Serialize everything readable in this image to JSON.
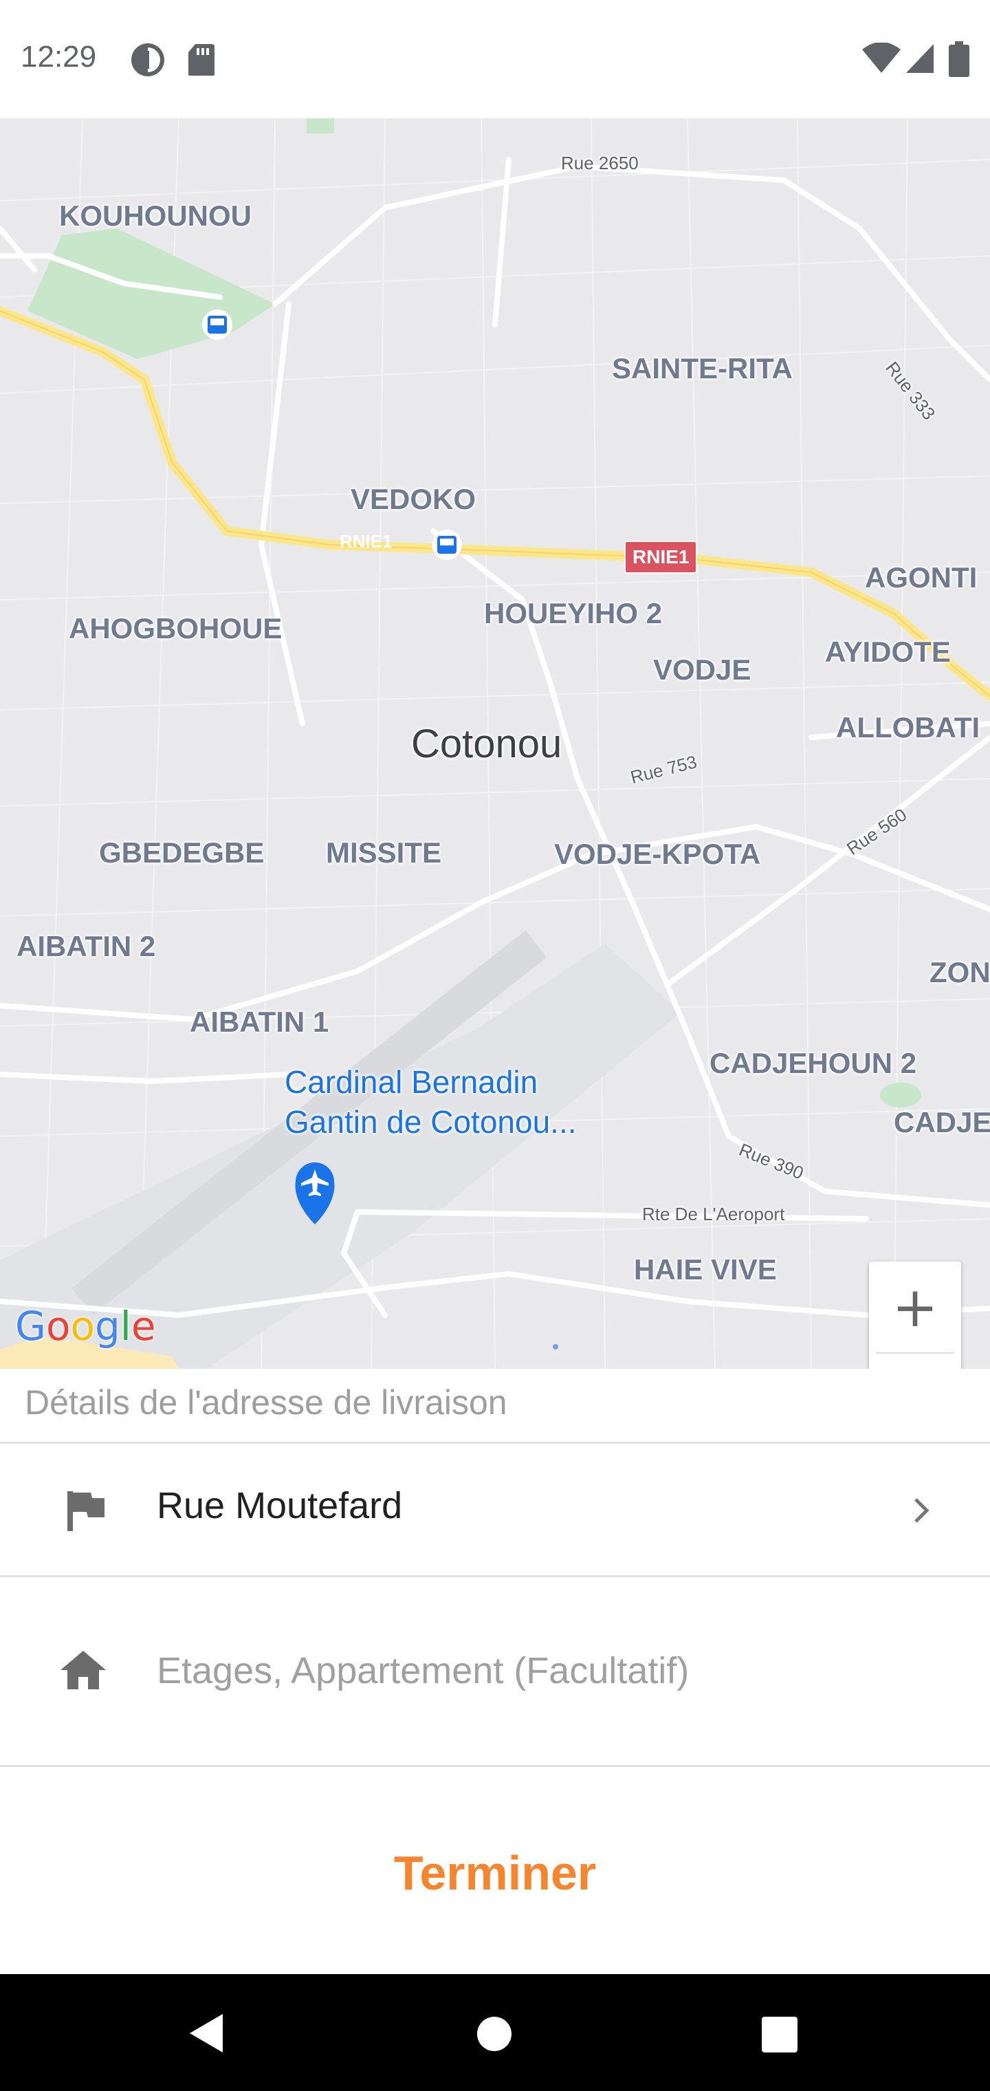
{
  "status_bar": {
    "time": "12:29",
    "icons": [
      "data-saver-icon",
      "sd-card-icon",
      "wifi-icon",
      "cell-signal-icon",
      "battery-icon"
    ]
  },
  "map": {
    "city": "Cotonou",
    "neighborhoods": {
      "kouhounou": "KOUHOUNOU",
      "sainte_rita": "SAINTE-RITA",
      "vedoko": "VEDOKO",
      "agonti": "AGONTI",
      "ahogbohoue": "AHOGBOHOUE",
      "houeyiho2": "HOUEYIHO 2",
      "ayidote": "AYIDOTE",
      "vodje": "VODJE",
      "allobati": "ALLOBATI",
      "gbedegbe": "GBEDEGBE",
      "missite": "MISSITE",
      "vodje_kpota": "VODJE-KPOTA",
      "aibatin2": "AIBATIN 2",
      "zon": "ZON",
      "aibatin1": "AIBATIN 1",
      "cadjehoun2": "CADJEHOUN 2",
      "cadjeh": "CADJEH",
      "haie_vive": "HAIE VIVE"
    },
    "streets": {
      "rue2650": "Rue 2650",
      "rue333": "Rue 333",
      "rnie1": "RNIE1",
      "rue753": "Rue 753",
      "rue560": "Rue 560",
      "rue390": "Rue 390",
      "rte_aeroport": "Rte De L'Aeroport"
    },
    "road_badge": "RNIE1",
    "poi": {
      "line1": "Cardinal Bernadin",
      "line2": "Gantin de Cotonou..."
    },
    "zoom_in": "+",
    "zoom_out": "−",
    "attribution": "Google",
    "colors": {
      "background": "#e9e9eb",
      "highway": "#fce68a",
      "park": "#c8e6c9",
      "water": "#bdd4f0",
      "poi_blue": "#1a73e8"
    }
  },
  "form": {
    "section_title": "Détails de l'adresse de livraison",
    "street": {
      "icon": "flag-icon",
      "value": "Rue Moutefard",
      "chevron": "chevron-right-icon"
    },
    "details": {
      "icon": "home-icon",
      "placeholder": "Etages, Appartement (Facultatif)"
    },
    "submit_label": "Terminer",
    "accent_color": "#f7852d"
  },
  "nav_bar": {
    "icons": [
      "back-icon",
      "home-circle-icon",
      "recents-icon"
    ]
  }
}
